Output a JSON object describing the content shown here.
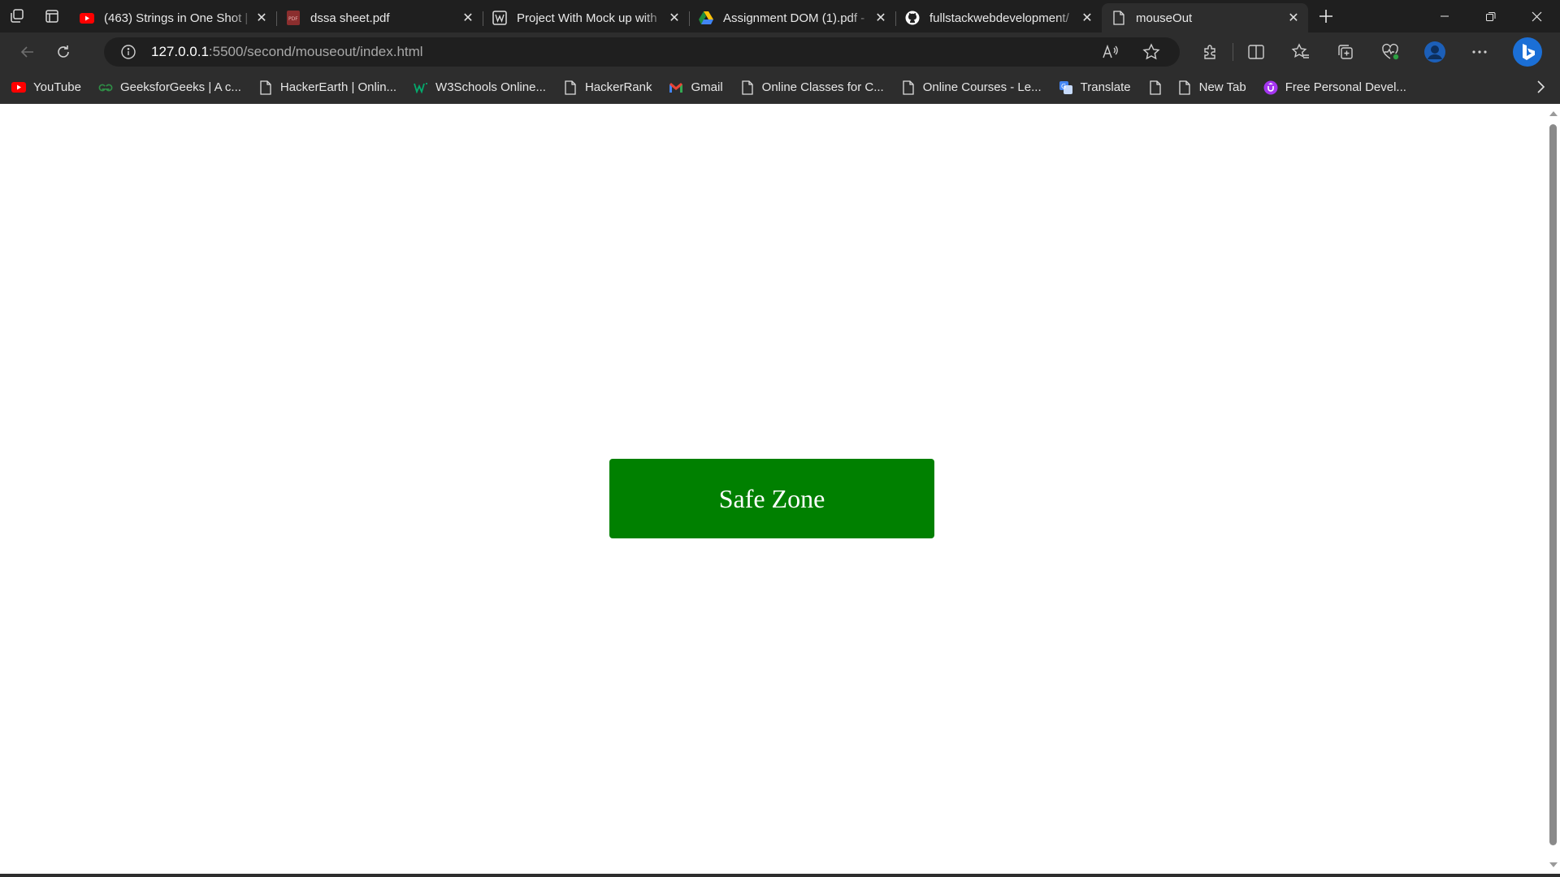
{
  "tabs": [
    {
      "title": "(463) Strings in One Shot |",
      "icon": "youtube-icon"
    },
    {
      "title": "dssa sheet.pdf",
      "icon": "pdf-icon"
    },
    {
      "title": "Project With Mock up with",
      "icon": "wordpress-icon"
    },
    {
      "title": "Assignment DOM (1).pdf -",
      "icon": "google-drive-icon"
    },
    {
      "title": "fullstackwebdevelopment/",
      "icon": "github-icon"
    },
    {
      "title": "mouseOut",
      "icon": "page-icon",
      "active": true
    }
  ],
  "address_bar": {
    "host": "127.0.0.1",
    "path": ":5500/second/mouseout/index.html"
  },
  "bookmarks": [
    {
      "label": "YouTube",
      "icon": "youtube-icon"
    },
    {
      "label": "GeeksforGeeks | A c...",
      "icon": "geeksforgeeks-icon"
    },
    {
      "label": "HackerEarth | Onlin...",
      "icon": "page-icon"
    },
    {
      "label": "W3Schools Online...",
      "icon": "w3schools-icon"
    },
    {
      "label": "HackerRank",
      "icon": "page-icon"
    },
    {
      "label": "Gmail",
      "icon": "gmail-icon"
    },
    {
      "label": "Online Classes for C...",
      "icon": "page-icon"
    },
    {
      "label": "Online Courses - Le...",
      "icon": "page-icon"
    },
    {
      "label": "Translate",
      "icon": "translate-icon"
    },
    {
      "label": "",
      "icon": "page-icon"
    },
    {
      "label": "New Tab",
      "icon": "page-icon"
    },
    {
      "label": "Free Personal Devel...",
      "icon": "udemy-icon"
    }
  ],
  "page": {
    "button_label": "Safe Zone",
    "button_color": "#008000"
  }
}
